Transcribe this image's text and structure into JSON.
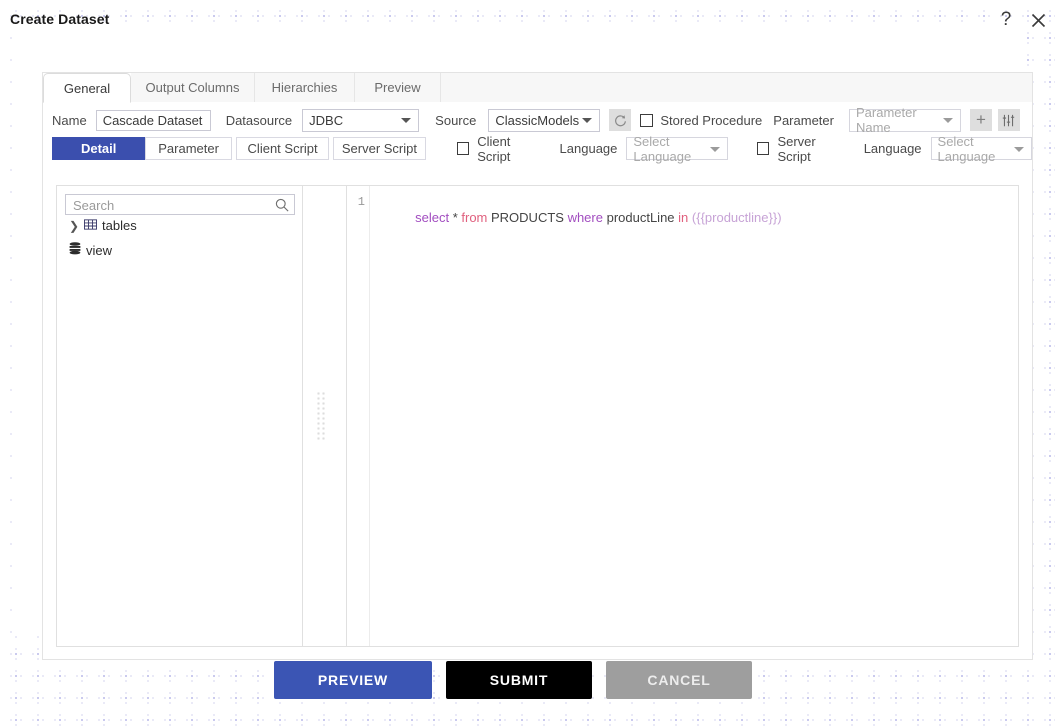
{
  "window": {
    "title": "Create Dataset",
    "help_icon": "question-mark-icon",
    "close_icon": "close-icon"
  },
  "tabs": [
    {
      "label": "General",
      "active": true
    },
    {
      "label": "Output Columns",
      "active": false
    },
    {
      "label": "Hierarchies",
      "active": false
    },
    {
      "label": "Preview",
      "active": false
    }
  ],
  "form": {
    "name_label": "Name",
    "name_value": "Cascade Dataset",
    "datasource_label": "Datasource",
    "datasource_value": "JDBC",
    "source_label": "Source",
    "source_value": "ClassicModels",
    "refresh_icon": "refresh-icon",
    "stored_procedure_label": "Stored Procedure",
    "stored_procedure_checked": false,
    "parameter_label": "Parameter",
    "parameter_name_placeholder": "Parameter Name",
    "add_icon": "plus-icon",
    "settings_icon": "sliders-icon"
  },
  "subtabs": [
    {
      "label": "Detail",
      "active": true
    },
    {
      "label": "Parameter",
      "active": false
    },
    {
      "label": "Client Script",
      "active": false
    },
    {
      "label": "Server Script",
      "active": false
    }
  ],
  "script_options": {
    "client_script_label": "Client Script",
    "client_script_checked": false,
    "client_language_label": "Language",
    "client_language_value": "Select Language",
    "server_script_label": "Server Script",
    "server_script_checked": false,
    "server_language_label": "Language",
    "server_language_value": "Select Language"
  },
  "tree": {
    "search_placeholder": "Search",
    "search_icon": "search-icon",
    "nodes": [
      {
        "label": "tables",
        "icon": "table-grid-icon",
        "expander": "chevron-right-icon"
      },
      {
        "label": "view",
        "icon": "database-stack-icon",
        "expander": ""
      }
    ]
  },
  "editor": {
    "line_number": "1",
    "tokens": [
      {
        "text": "select",
        "type": "keyword"
      },
      {
        "text": " * ",
        "type": "plain"
      },
      {
        "text": "from",
        "type": "function"
      },
      {
        "text": " PRODUCTS ",
        "type": "plain"
      },
      {
        "text": "where",
        "type": "keyword"
      },
      {
        "text": " productLine ",
        "type": "plain"
      },
      {
        "text": "in",
        "type": "function"
      },
      {
        "text": " (",
        "type": "plain"
      },
      {
        "text": "{{productline}}",
        "type": "token"
      },
      {
        "text": ")",
        "type": "plain"
      }
    ],
    "full_text": "select * from PRODUCTS where productLine in ({{productline}})"
  },
  "footer": {
    "preview_label": "PREVIEW",
    "submit_label": "SUBMIT",
    "cancel_label": "CANCEL"
  },
  "colors": {
    "accent_blue": "#3b4fae",
    "preview_blue": "#3b55b4",
    "submit_black": "#000000",
    "cancel_gray": "#9e9e9e"
  }
}
